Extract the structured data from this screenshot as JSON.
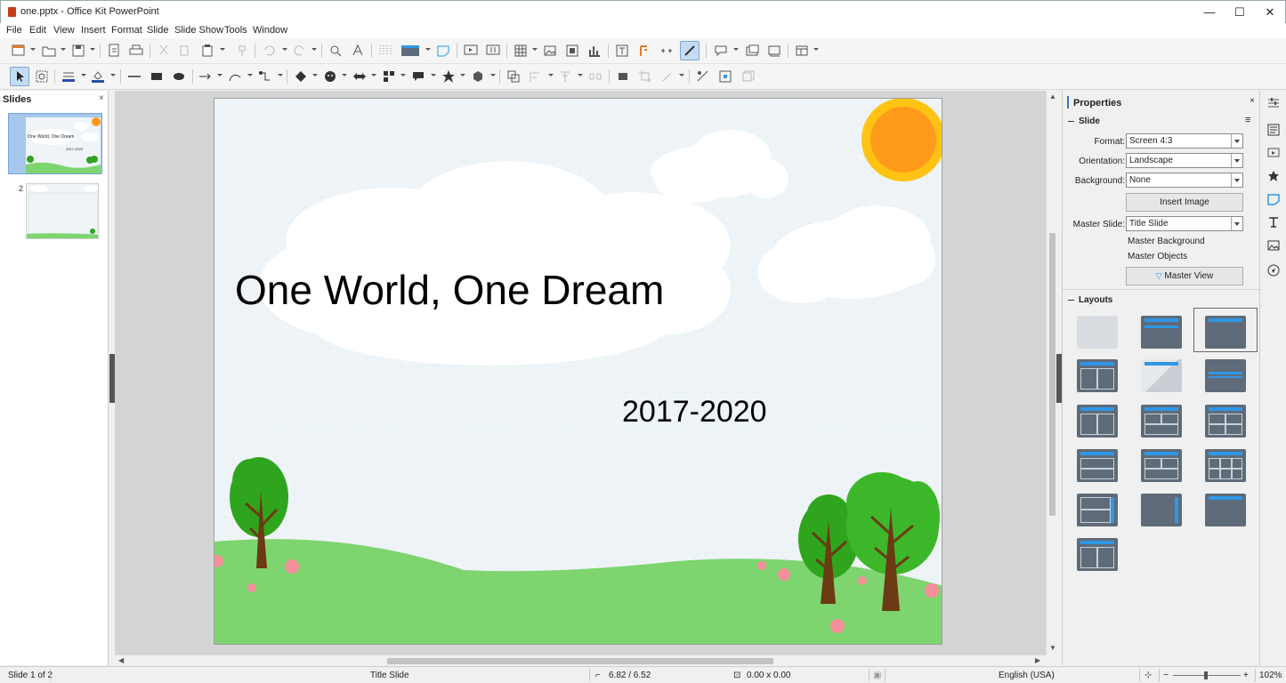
{
  "window": {
    "title": "one.pptx - Office Kit PowerPoint",
    "minimize": "—",
    "maximize": "☐",
    "close": "✕"
  },
  "menu": [
    "File",
    "Edit",
    "View",
    "Insert",
    "Format",
    "Slide",
    "Slide Show",
    "Tools",
    "Window"
  ],
  "slides_panel": {
    "title": "Slides",
    "close": "×",
    "thumbs": [
      {
        "number": "1",
        "title": "One World, One Dream",
        "subtitle": "2017-2020",
        "selected": true
      },
      {
        "number": "2",
        "title": "",
        "subtitle": "",
        "selected": false
      }
    ]
  },
  "slide": {
    "title": "One World, One Dream",
    "subtitle": "2017-2020",
    "colors": {
      "sky": "#eef4f7",
      "grass": "#7ed46f",
      "sun": "#ff9a1a",
      "sun_ring": "#ffc313",
      "tree": "#2fa51e",
      "trunk": "#6b3a12",
      "flower": "#f58f9a",
      "cloud": "#ffffff"
    }
  },
  "properties": {
    "title": "Properties",
    "close": "×",
    "slide_section": "Slide",
    "format_label": "Format:",
    "format_value": "Screen 4:3",
    "orientation_label": "Orientation:",
    "orientation_value": "Landscape",
    "background_label": "Background:",
    "background_value": "None",
    "insert_image": "Insert Image",
    "master_slide_label": "Master Slide:",
    "master_slide_value": "Title Slide",
    "master_background": "Master Background",
    "master_objects": "Master Objects",
    "master_view": "Master View",
    "layouts_section": "Layouts"
  },
  "status": {
    "slide_info": "Slide 1 of 2",
    "layout": "Title Slide",
    "position": "6.82 / 6.52",
    "size": "0.00 x 0.00",
    "language": "English (USA)",
    "zoom": "102%"
  },
  "accent_color": "#2f97e6"
}
